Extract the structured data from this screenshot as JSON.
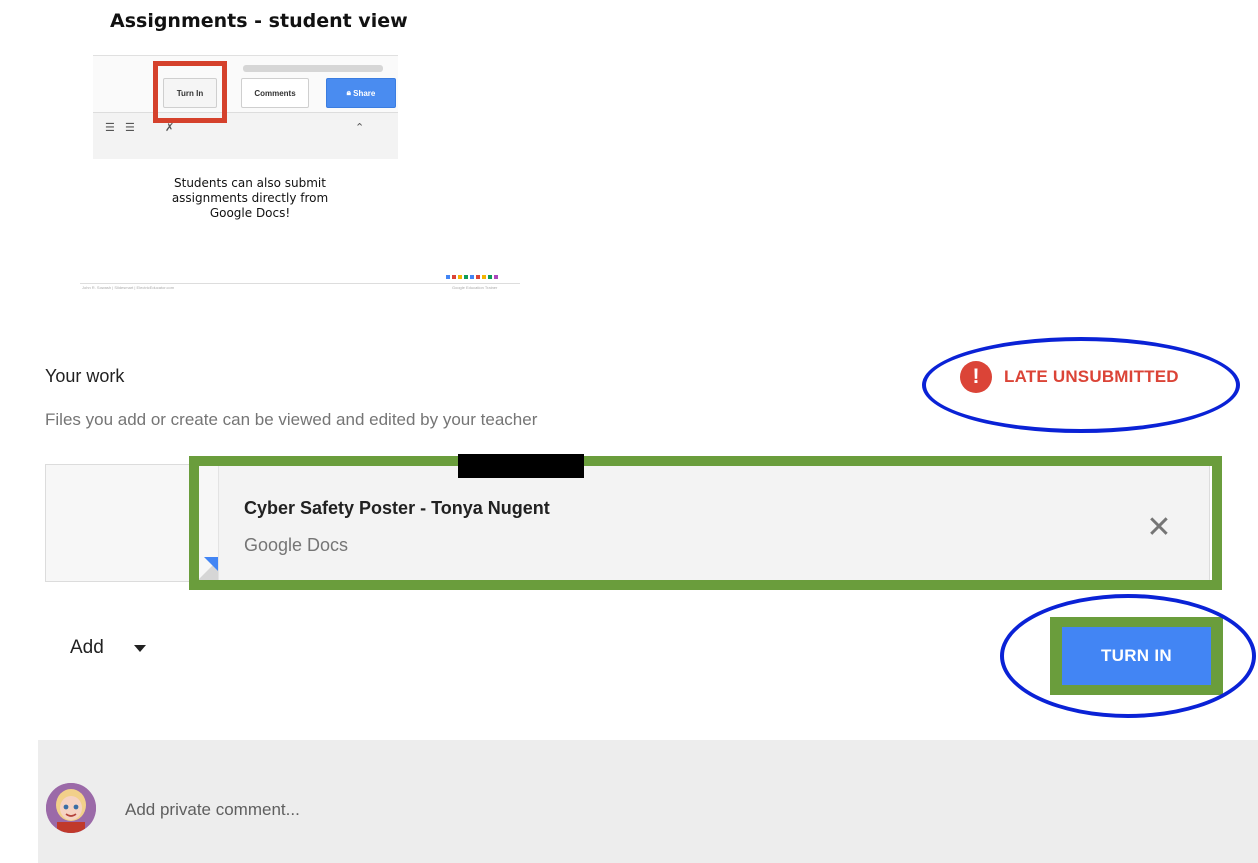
{
  "slide": {
    "title": "Assignments - student view",
    "buttons": {
      "turn_in": "Turn In",
      "comments": "Comments",
      "share": "Share"
    },
    "caption_lines": [
      "Students can also submit",
      "assignments directly from",
      "Google Docs!"
    ],
    "footer_left": "John R. Sowash | Slidesmart | ElectricEducator.com",
    "footer_right": "Google Education Trainer"
  },
  "your_work": {
    "title": "Your work",
    "description": "Files you add or create can be viewed and edited by your teacher",
    "status": "LATE UNSUBMITTED",
    "status_icon": "!"
  },
  "attachment": {
    "title": "Cyber Safety Poster - Tonya Nugent",
    "type": "Google Docs",
    "remove_glyph": "✕"
  },
  "actions": {
    "add_label": "Add",
    "turn_in_label": "TURN IN"
  },
  "comment": {
    "placeholder": "Add private comment..."
  },
  "colors": {
    "accent_blue": "#4285f4",
    "late_red": "#db4437",
    "highlight_green": "#6a9d3c",
    "highlight_oval": "#0a22d6"
  }
}
